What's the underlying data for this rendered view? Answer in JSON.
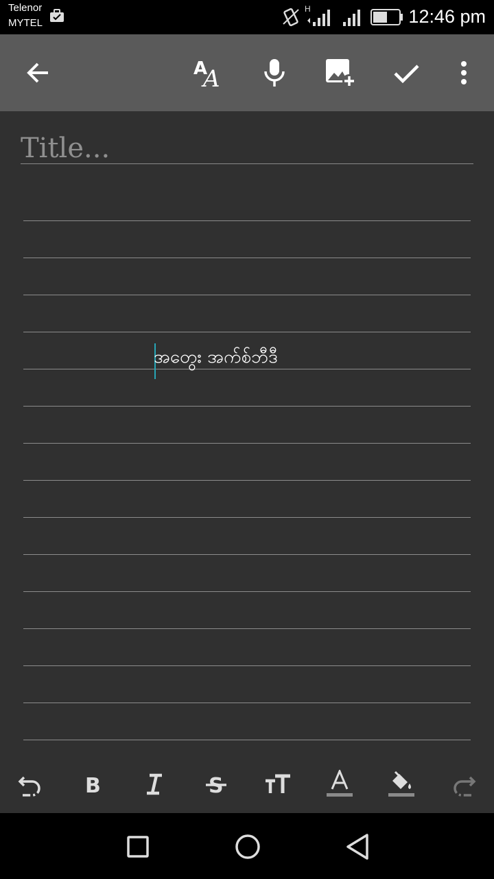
{
  "status_bar": {
    "carrier_1": "Telenor",
    "carrier_2": "MYTEL",
    "network_type": "H",
    "time": "12:46 pm",
    "icons": [
      "briefcase-icon",
      "vibrate-icon",
      "signal-icon",
      "battery-icon"
    ]
  },
  "toolbar": {
    "background": "#5a5a5a",
    "buttons": [
      "back-arrow-icon",
      "text-format-icon",
      "microphone-icon",
      "add-image-icon",
      "checkmark-icon",
      "more-options-icon"
    ]
  },
  "editor": {
    "title_placeholder": "Title...",
    "body_text": "အတွေး အက်စ်ဘီဒီ",
    "caret_color": "#27a6b6"
  },
  "format_bar": {
    "buttons": [
      "undo-icon",
      "bold-icon",
      "italic-icon",
      "strikethrough-icon",
      "text-size-icon",
      "text-color-icon",
      "fill-color-icon",
      "redo-icon"
    ]
  },
  "nav_bar": {
    "buttons": [
      "recents-icon",
      "home-icon",
      "back-icon"
    ]
  }
}
